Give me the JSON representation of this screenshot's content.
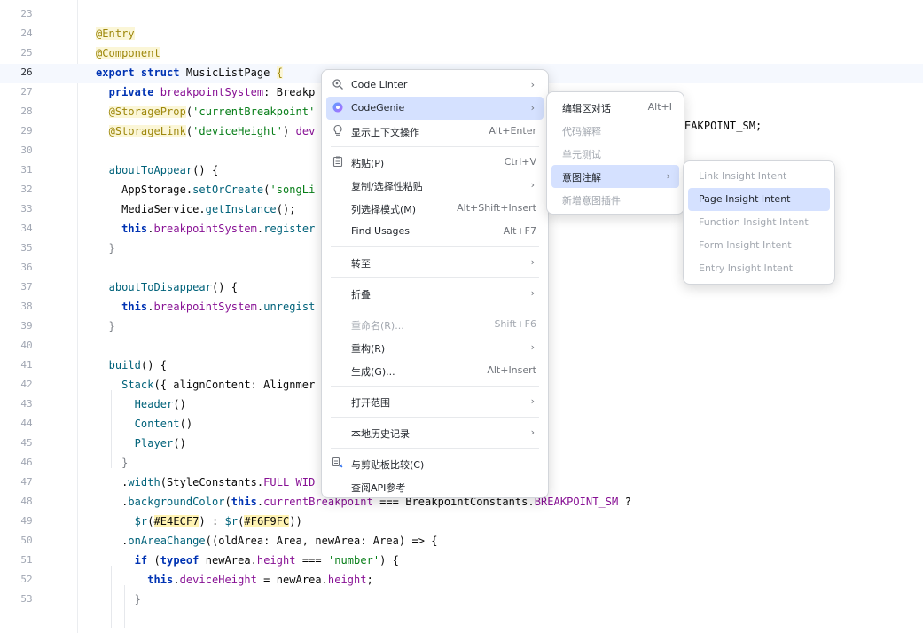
{
  "editor": {
    "lines": [
      {
        "n": "23",
        "tokens": []
      },
      {
        "n": "24",
        "tokens": [
          {
            "c": "t-ann",
            "t": "@Entry"
          }
        ]
      },
      {
        "n": "25",
        "tokens": [
          {
            "c": "t-ann",
            "t": "@Component"
          }
        ]
      },
      {
        "n": "26",
        "current": true,
        "tokens": [
          {
            "c": "t-kw",
            "t": "export struct "
          },
          {
            "c": "",
            "t": "MusicListPage "
          },
          {
            "c": "t-ann",
            "t": "{"
          }
        ]
      },
      {
        "n": "27",
        "tokens": [
          {
            "c": "",
            "t": "  "
          },
          {
            "c": "t-kw",
            "t": "private "
          },
          {
            "c": "t-const",
            "t": "breakpointSystem"
          },
          {
            "c": "",
            "t": ": Breakp"
          }
        ]
      },
      {
        "n": "28",
        "tokens": [
          {
            "c": "",
            "t": "  "
          },
          {
            "c": "t-ann",
            "t": "@StorageProp"
          },
          {
            "c": "",
            "t": "("
          },
          {
            "c": "t-str",
            "t": "'currentBreakpoint'"
          }
        ]
      },
      {
        "n": "29",
        "tokens": [
          {
            "c": "",
            "t": "  "
          },
          {
            "c": "t-ann",
            "t": "@StorageLink"
          },
          {
            "c": "",
            "t": "("
          },
          {
            "c": "t-str",
            "t": "'deviceHeight'"
          },
          {
            "c": "",
            "t": ") "
          },
          {
            "c": "t-const",
            "t": "dev"
          }
        ]
      },
      {
        "n": "30",
        "tokens": []
      },
      {
        "n": "31",
        "tokens": [
          {
            "c": "",
            "t": "  "
          },
          {
            "c": "t-fn",
            "t": "aboutToAppear"
          },
          {
            "c": "",
            "t": "() {"
          }
        ]
      },
      {
        "n": "32",
        "tokens": [
          {
            "c": "",
            "t": "    AppStorage."
          },
          {
            "c": "t-fn",
            "t": "setOrCreate"
          },
          {
            "c": "",
            "t": "("
          },
          {
            "c": "t-str",
            "t": "'songLi"
          }
        ]
      },
      {
        "n": "33",
        "tokens": [
          {
            "c": "",
            "t": "    MediaService."
          },
          {
            "c": "t-fn",
            "t": "getInstance"
          },
          {
            "c": "",
            "t": "();"
          }
        ]
      },
      {
        "n": "34",
        "tokens": [
          {
            "c": "",
            "t": "    "
          },
          {
            "c": "t-kw",
            "t": "this"
          },
          {
            "c": "",
            "t": "."
          },
          {
            "c": "t-const",
            "t": "breakpointSystem"
          },
          {
            "c": "",
            "t": "."
          },
          {
            "c": "t-fn",
            "t": "register"
          }
        ]
      },
      {
        "n": "35",
        "tokens": [
          {
            "c": "t-dim",
            "t": "  }"
          }
        ]
      },
      {
        "n": "36",
        "tokens": []
      },
      {
        "n": "37",
        "tokens": [
          {
            "c": "",
            "t": "  "
          },
          {
            "c": "t-fn",
            "t": "aboutToDisappear"
          },
          {
            "c": "",
            "t": "() {"
          }
        ]
      },
      {
        "n": "38",
        "tokens": [
          {
            "c": "",
            "t": "    "
          },
          {
            "c": "t-kw",
            "t": "this"
          },
          {
            "c": "",
            "t": "."
          },
          {
            "c": "t-const",
            "t": "breakpointSystem"
          },
          {
            "c": "",
            "t": "."
          },
          {
            "c": "t-fn",
            "t": "unregist"
          }
        ]
      },
      {
        "n": "39",
        "tokens": [
          {
            "c": "t-dim",
            "t": "  }"
          }
        ]
      },
      {
        "n": "40",
        "tokens": []
      },
      {
        "n": "41",
        "tokens": [
          {
            "c": "",
            "t": "  "
          },
          {
            "c": "t-fn",
            "t": "build"
          },
          {
            "c": "",
            "t": "() {"
          }
        ]
      },
      {
        "n": "42",
        "tokens": [
          {
            "c": "",
            "t": "    "
          },
          {
            "c": "t-fn",
            "t": "Stack"
          },
          {
            "c": "",
            "t": "({ alignContent: Alignmer"
          }
        ]
      },
      {
        "n": "43",
        "tokens": [
          {
            "c": "",
            "t": "      "
          },
          {
            "c": "t-fn",
            "t": "Header"
          },
          {
            "c": "",
            "t": "()"
          }
        ]
      },
      {
        "n": "44",
        "tokens": [
          {
            "c": "",
            "t": "      "
          },
          {
            "c": "t-fn",
            "t": "Content"
          },
          {
            "c": "",
            "t": "()"
          }
        ]
      },
      {
        "n": "45",
        "tokens": [
          {
            "c": "",
            "t": "      "
          },
          {
            "c": "t-fn",
            "t": "Player"
          },
          {
            "c": "",
            "t": "()"
          }
        ]
      },
      {
        "n": "46",
        "tokens": [
          {
            "c": "t-dim",
            "t": "    }"
          }
        ]
      },
      {
        "n": "47",
        "tokens": [
          {
            "c": "",
            "t": "    ."
          },
          {
            "c": "t-fn",
            "t": "width"
          },
          {
            "c": "",
            "t": "(StyleConstants."
          },
          {
            "c": "t-const",
            "t": "FULL_WID"
          }
        ]
      },
      {
        "n": "48",
        "tokens": [
          {
            "c": "",
            "t": "    ."
          },
          {
            "c": "t-fn",
            "t": "backgroundColor"
          },
          {
            "c": "",
            "t": "("
          },
          {
            "c": "t-kw",
            "t": "this"
          },
          {
            "c": "",
            "t": "."
          },
          {
            "c": "t-const",
            "t": "currentBreakpoint"
          },
          {
            "c": "",
            "t": " === BreakpointConstants."
          },
          {
            "c": "t-const",
            "t": "BREAKPOINT_SM"
          },
          {
            "c": "",
            "t": " ?"
          }
        ]
      },
      {
        "n": "49",
        "tokens": [
          {
            "c": "",
            "t": "      "
          },
          {
            "c": "t-fn",
            "t": "$r"
          },
          {
            "c": "",
            "t": "("
          },
          {
            "c": "t-hex",
            "t": "#E4ECF7"
          },
          {
            "c": "",
            "t": ") : "
          },
          {
            "c": "t-fn",
            "t": "$r"
          },
          {
            "c": "",
            "t": "("
          },
          {
            "c": "t-hex",
            "t": "#F6F9FC"
          },
          {
            "c": "",
            "t": "))"
          }
        ]
      },
      {
        "n": "50",
        "tokens": [
          {
            "c": "",
            "t": "    ."
          },
          {
            "c": "t-fn",
            "t": "onAreaChange"
          },
          {
            "c": "",
            "t": "((oldArea: Area, newArea: Area) => {"
          }
        ]
      },
      {
        "n": "51",
        "tokens": [
          {
            "c": "",
            "t": "      "
          },
          {
            "c": "t-kw",
            "t": "if"
          },
          {
            "c": "",
            "t": " ("
          },
          {
            "c": "t-kw",
            "t": "typeof"
          },
          {
            "c": "",
            "t": " newArea."
          },
          {
            "c": "t-const",
            "t": "height"
          },
          {
            "c": "",
            "t": " === "
          },
          {
            "c": "t-str",
            "t": "'number'"
          },
          {
            "c": "",
            "t": ") {"
          }
        ]
      },
      {
        "n": "52",
        "tokens": [
          {
            "c": "",
            "t": "        "
          },
          {
            "c": "t-kw",
            "t": "this"
          },
          {
            "c": "",
            "t": "."
          },
          {
            "c": "t-const",
            "t": "deviceHeight"
          },
          {
            "c": "",
            "t": " = newArea."
          },
          {
            "c": "t-const",
            "t": "height"
          },
          {
            "c": "",
            "t": ";"
          }
        ]
      },
      {
        "n": "53",
        "tokens": [
          {
            "c": "t-dim",
            "t": "      }"
          }
        ]
      }
    ],
    "hidden_right_text": "EAKPOINT_SM;"
  },
  "context_menu": {
    "items": [
      {
        "type": "item",
        "id": "code-linter",
        "label": "Code Linter",
        "icon": "linter-icon",
        "arrow": true
      },
      {
        "type": "item",
        "id": "codegenie",
        "label": "CodeGenie",
        "icon": "codegenie-icon",
        "arrow": true,
        "selected": true
      },
      {
        "type": "item",
        "id": "show-context-actions",
        "label": "显示上下文操作",
        "icon": "bulb-icon",
        "shortcut": "Alt+Enter"
      },
      {
        "type": "sep"
      },
      {
        "type": "item",
        "id": "paste",
        "label": "粘贴(P)",
        "icon": "clipboard-icon",
        "shortcut": "Ctrl+V"
      },
      {
        "type": "item",
        "id": "copy-paste-special",
        "label": "复制/选择性粘贴",
        "arrow": true
      },
      {
        "type": "item",
        "id": "column-selection",
        "label": "列选择模式(M)",
        "shortcut": "Alt+Shift+Insert"
      },
      {
        "type": "item",
        "id": "find-usages",
        "label": "Find Usages",
        "shortcut": "Alt+F7"
      },
      {
        "type": "sep"
      },
      {
        "type": "item",
        "id": "goto",
        "label": "转至",
        "arrow": true
      },
      {
        "type": "sep"
      },
      {
        "type": "item",
        "id": "folding",
        "label": "折叠",
        "arrow": true
      },
      {
        "type": "sep"
      },
      {
        "type": "item",
        "id": "rename",
        "label": "重命名(R)...",
        "shortcut": "Shift+F6",
        "disabled": true
      },
      {
        "type": "item",
        "id": "refactor",
        "label": "重构(R)",
        "arrow": true
      },
      {
        "type": "item",
        "id": "generate",
        "label": "生成(G)...",
        "shortcut": "Alt+Insert"
      },
      {
        "type": "sep"
      },
      {
        "type": "item",
        "id": "open-in",
        "label": "打开范围",
        "arrow": true
      },
      {
        "type": "sep"
      },
      {
        "type": "item",
        "id": "local-history",
        "label": "本地历史记录",
        "arrow": true
      },
      {
        "type": "sep"
      },
      {
        "type": "item",
        "id": "compare-clipboard",
        "label": "与剪贴板比较(C)",
        "icon": "compare-icon"
      },
      {
        "type": "item",
        "id": "api-reference",
        "label": "查阅API参考"
      }
    ]
  },
  "codegenie_menu": {
    "items": [
      {
        "id": "editor-chat",
        "label": "编辑区对话",
        "shortcut": "Alt+I"
      },
      {
        "id": "explain-code",
        "label": "代码解释",
        "disabled": true
      },
      {
        "id": "unit-test",
        "label": "单元测试",
        "disabled": true
      },
      {
        "id": "intent-annotation",
        "label": "意图注解",
        "arrow": true,
        "selected": true
      },
      {
        "id": "new-intent-plugin",
        "label": "新增意图插件",
        "disabled": true
      }
    ]
  },
  "intent_menu": {
    "items": [
      {
        "id": "link-insight-intent",
        "label": "Link Insight Intent",
        "disabled": true
      },
      {
        "id": "page-insight-intent",
        "label": "Page Insight Intent",
        "selected": true
      },
      {
        "id": "function-insight-intent",
        "label": "Function Insight Intent",
        "disabled": true
      },
      {
        "id": "form-insight-intent",
        "label": "Form Insight Intent",
        "disabled": true
      },
      {
        "id": "entry-insight-intent",
        "label": "Entry Insight Intent",
        "disabled": true
      }
    ]
  },
  "colors": {
    "selection": "#d5e1ff",
    "current_line": "#f5f8fe",
    "keyword": "#0033b3",
    "annotation": "#9e880d"
  }
}
